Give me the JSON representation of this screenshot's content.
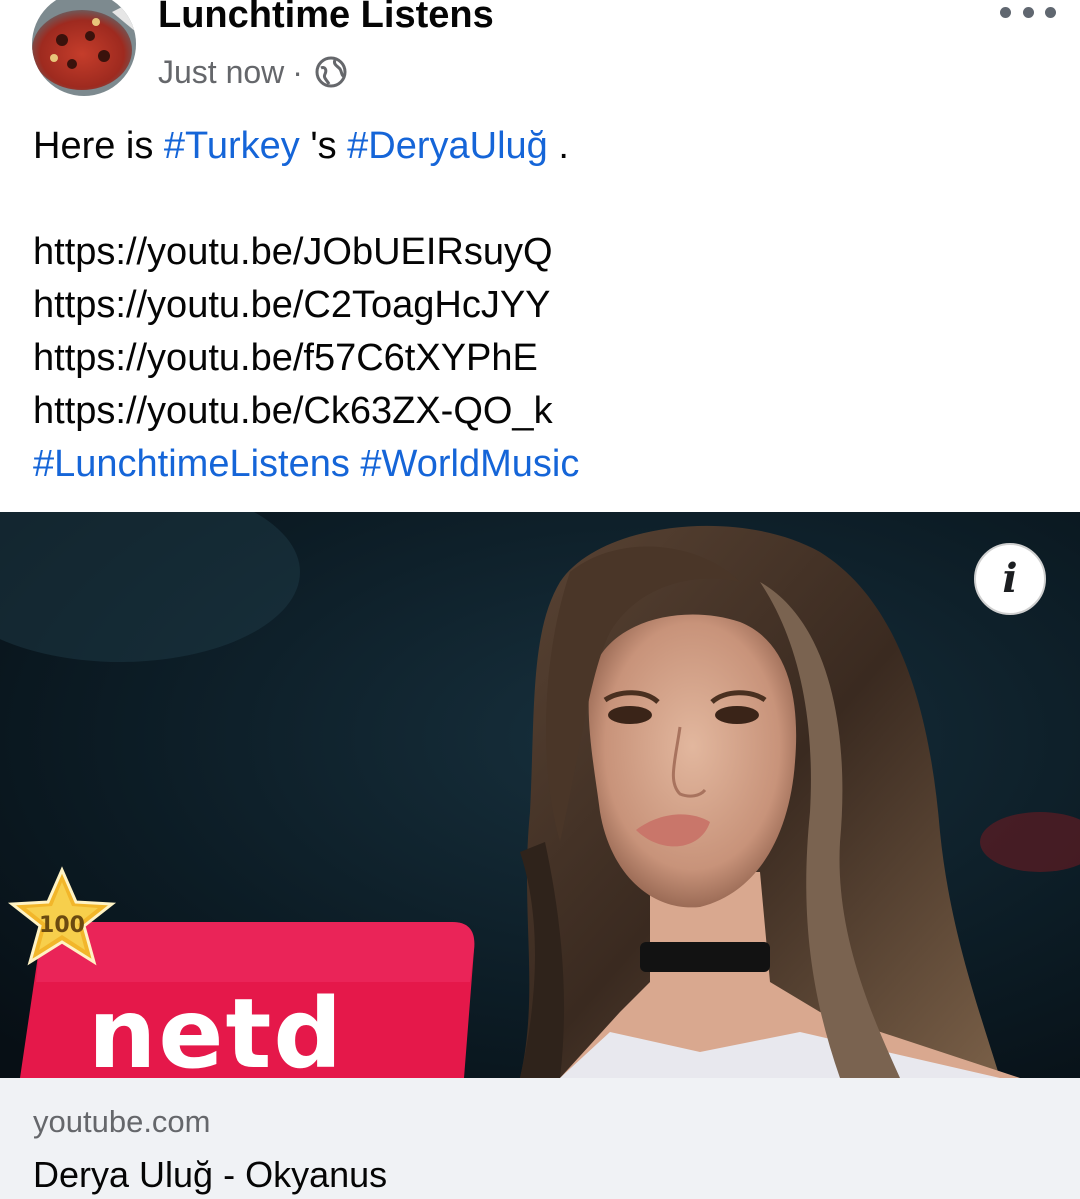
{
  "post": {
    "page_name": "Lunchtime Listens",
    "timestamp": "Just now",
    "separator": "·",
    "privacy_icon": "globe-icon",
    "more_icon": "more-options-icon",
    "text": {
      "line1_prefix": "Here is ",
      "hashtag_turkey": "#Turkey",
      "line1_middle": " 's ",
      "hashtag_derya": "#DeryaUluğ",
      "line1_suffix": " .",
      "links": [
        "https://youtu.be/JObUEIRsuyQ",
        "https://youtu.be/C2ToagHcJYY",
        "https://youtu.be/f57C6tXYPhE",
        "https://youtu.be/Ck63ZX-QO_k"
      ],
      "hashtag_lunchtime": "#LunchtimeListens",
      "hashtag_world": "#WorldMusic"
    }
  },
  "media": {
    "info_icon": "info-icon",
    "info_label": "i",
    "badge_number": "100",
    "logo_text": "netd"
  },
  "link_preview": {
    "domain": "youtube.com",
    "title": "Derya Uluğ - Okyanus"
  },
  "colors": {
    "hashtag": "#1565d8",
    "secondary_text": "#65676b",
    "link_box_bg": "#f0f2f5",
    "netd_red": "#e5184a"
  }
}
